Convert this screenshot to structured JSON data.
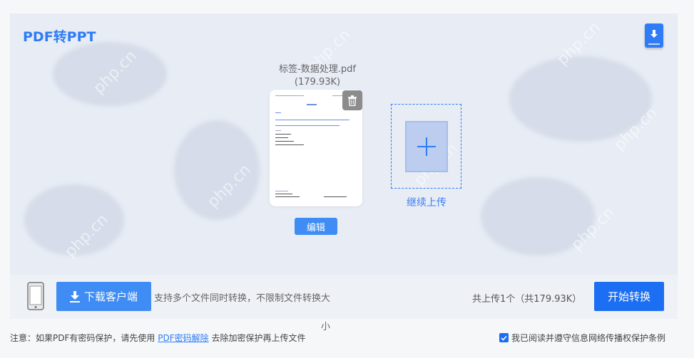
{
  "page": {
    "title": "PDF转PPT",
    "accent_color": "#2f7cf6",
    "watermark_text": "php.cn"
  },
  "file": {
    "name": "标签-数据处理.pdf",
    "size": "(179.93K)",
    "delete_icon": "trash-icon"
  },
  "actions": {
    "edit_label": "编辑",
    "continue_upload_label": "继续上传",
    "corner_icon": "download-file-icon"
  },
  "bottom_bar": {
    "download_client_label": "下载客户端",
    "support_text": "支持多个文件同时转换，不限制文件转换大",
    "support_text_wrap": "小",
    "count_text": "共上传1个（共179.93K）",
    "start_label": "开始转换"
  },
  "footer": {
    "notice_prefix": "注意：如果PDF有密码保护，请先使用",
    "notice_link": "PDF密码解除",
    "notice_suffix": "去除加密保护再上传文件",
    "agree_checked": true,
    "agree_text": "我已阅读并遵守信息网络传播权保护条例"
  }
}
